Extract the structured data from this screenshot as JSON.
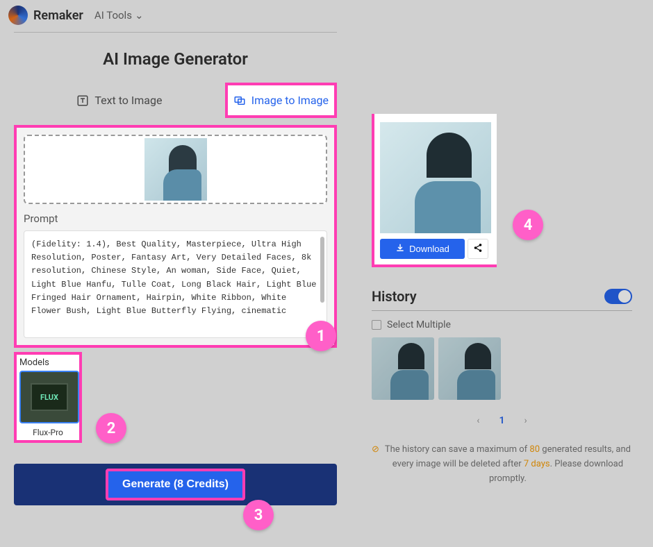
{
  "header": {
    "brand": "Remaker",
    "tools_label": "AI Tools"
  },
  "page": {
    "title": "AI Image Generator"
  },
  "tabs": {
    "text_to_image": "Text to Image",
    "image_to_image": "Image to Image"
  },
  "prompt": {
    "label": "Prompt",
    "value": "(Fidelity: 1.4), Best Quality, Masterpiece, Ultra High Resolution, Poster, Fantasy Art, Very Detailed Faces, 8k resolution, Chinese Style, An woman, Side Face, Quiet, Light Blue Hanfu, Tulle Coat, Long Black Hair, Light Blue Fringed Hair Ornament, Hairpin, White Ribbon, White Flower Bush, Light Blue Butterfly Flying, cinematic"
  },
  "models": {
    "label": "Models",
    "flux_tag": "FLUX",
    "selected_name": "Flux-Pro"
  },
  "generate": {
    "label": "Generate (8 Credits)"
  },
  "result": {
    "download": "Download"
  },
  "history": {
    "title": "History",
    "select_label": "Select Multiple",
    "page_current": "1",
    "note_before": "The history can save a maximum of ",
    "note_max": "80",
    "note_mid": " generated results, and every image will be deleted after ",
    "note_days": "7 days",
    "note_after": ". Please download promptly."
  },
  "steps": {
    "s1": "1",
    "s2": "2",
    "s3": "3",
    "s4": "4"
  }
}
